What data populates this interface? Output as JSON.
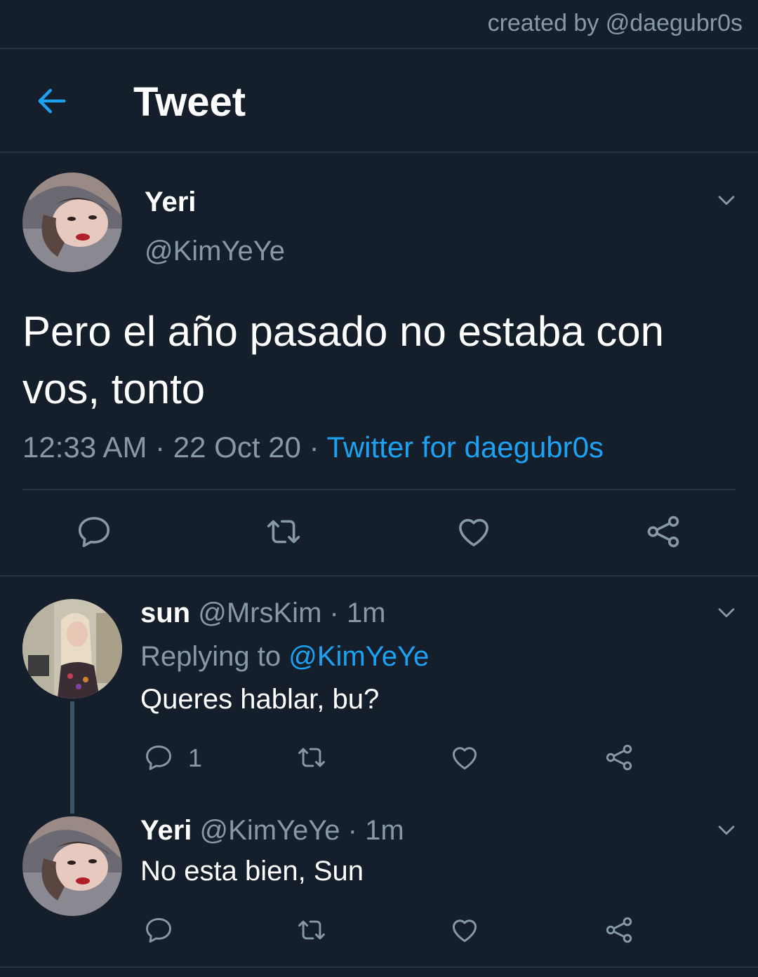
{
  "credit": "created by @daegubr0s",
  "header": {
    "title": "Tweet"
  },
  "main_tweet": {
    "name": "Yeri",
    "handle": "@KimYeYe",
    "text_line1": "Pero el año pasado no estaba con",
    "text_line2": "vos, tonto",
    "time": "12:33 AM",
    "sep1": " · ",
    "date": "22 Oct 20",
    "sep2": " · ",
    "source": "Twitter for daegubr0s"
  },
  "replies": [
    {
      "name": "sun",
      "handle": "@MrsKim",
      "sep": " · ",
      "time": "1m",
      "replying_prefix": "Replying to ",
      "replying_to": "@KimYeYe",
      "text": "Queres hablar, bu?",
      "reply_count": "1"
    },
    {
      "name": "Yeri",
      "handle": "@KimYeYe",
      "sep": " · ",
      "time": "1m",
      "text": "No esta bien, Sun"
    }
  ],
  "colors": {
    "background": "#151f2b",
    "divider": "#253341",
    "secondary_text": "#8899a6",
    "accent": "#1da1f2"
  },
  "icons": [
    "back-arrow-icon",
    "chevron-down-icon",
    "reply-icon",
    "retweet-icon",
    "like-icon",
    "share-icon"
  ]
}
